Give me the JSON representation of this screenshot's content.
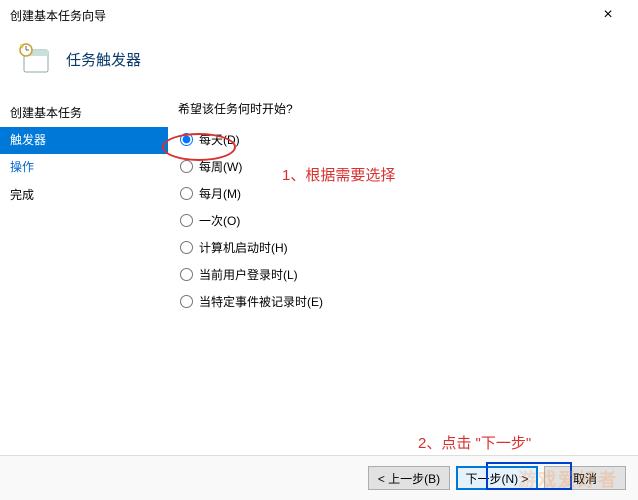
{
  "window": {
    "title": "创建基本任务向导",
    "close": "×"
  },
  "header": {
    "title": "任务触发器"
  },
  "sidebar": {
    "items": [
      {
        "label": "创建基本任务",
        "selected": false,
        "link": false
      },
      {
        "label": "触发器",
        "selected": true,
        "link": false
      },
      {
        "label": "操作",
        "selected": false,
        "link": true
      },
      {
        "label": "完成",
        "selected": false,
        "link": false
      }
    ]
  },
  "main": {
    "prompt": "希望该任务何时开始?",
    "options": [
      {
        "label": "每天(D)",
        "checked": true
      },
      {
        "label": "每周(W)",
        "checked": false
      },
      {
        "label": "每月(M)",
        "checked": false
      },
      {
        "label": "一次(O)",
        "checked": false
      },
      {
        "label": "计算机启动时(H)",
        "checked": false
      },
      {
        "label": "当前用户登录时(L)",
        "checked": false
      },
      {
        "label": "当特定事件被记录时(E)",
        "checked": false
      }
    ]
  },
  "footer": {
    "back": "< 上一步(B)",
    "next": "下一步(N) >",
    "cancel": "取消"
  },
  "annotations": {
    "note1": "1、根据需要选择",
    "note2": "2、点击 \"下一步\"",
    "watermark": "游戏爱好者"
  }
}
